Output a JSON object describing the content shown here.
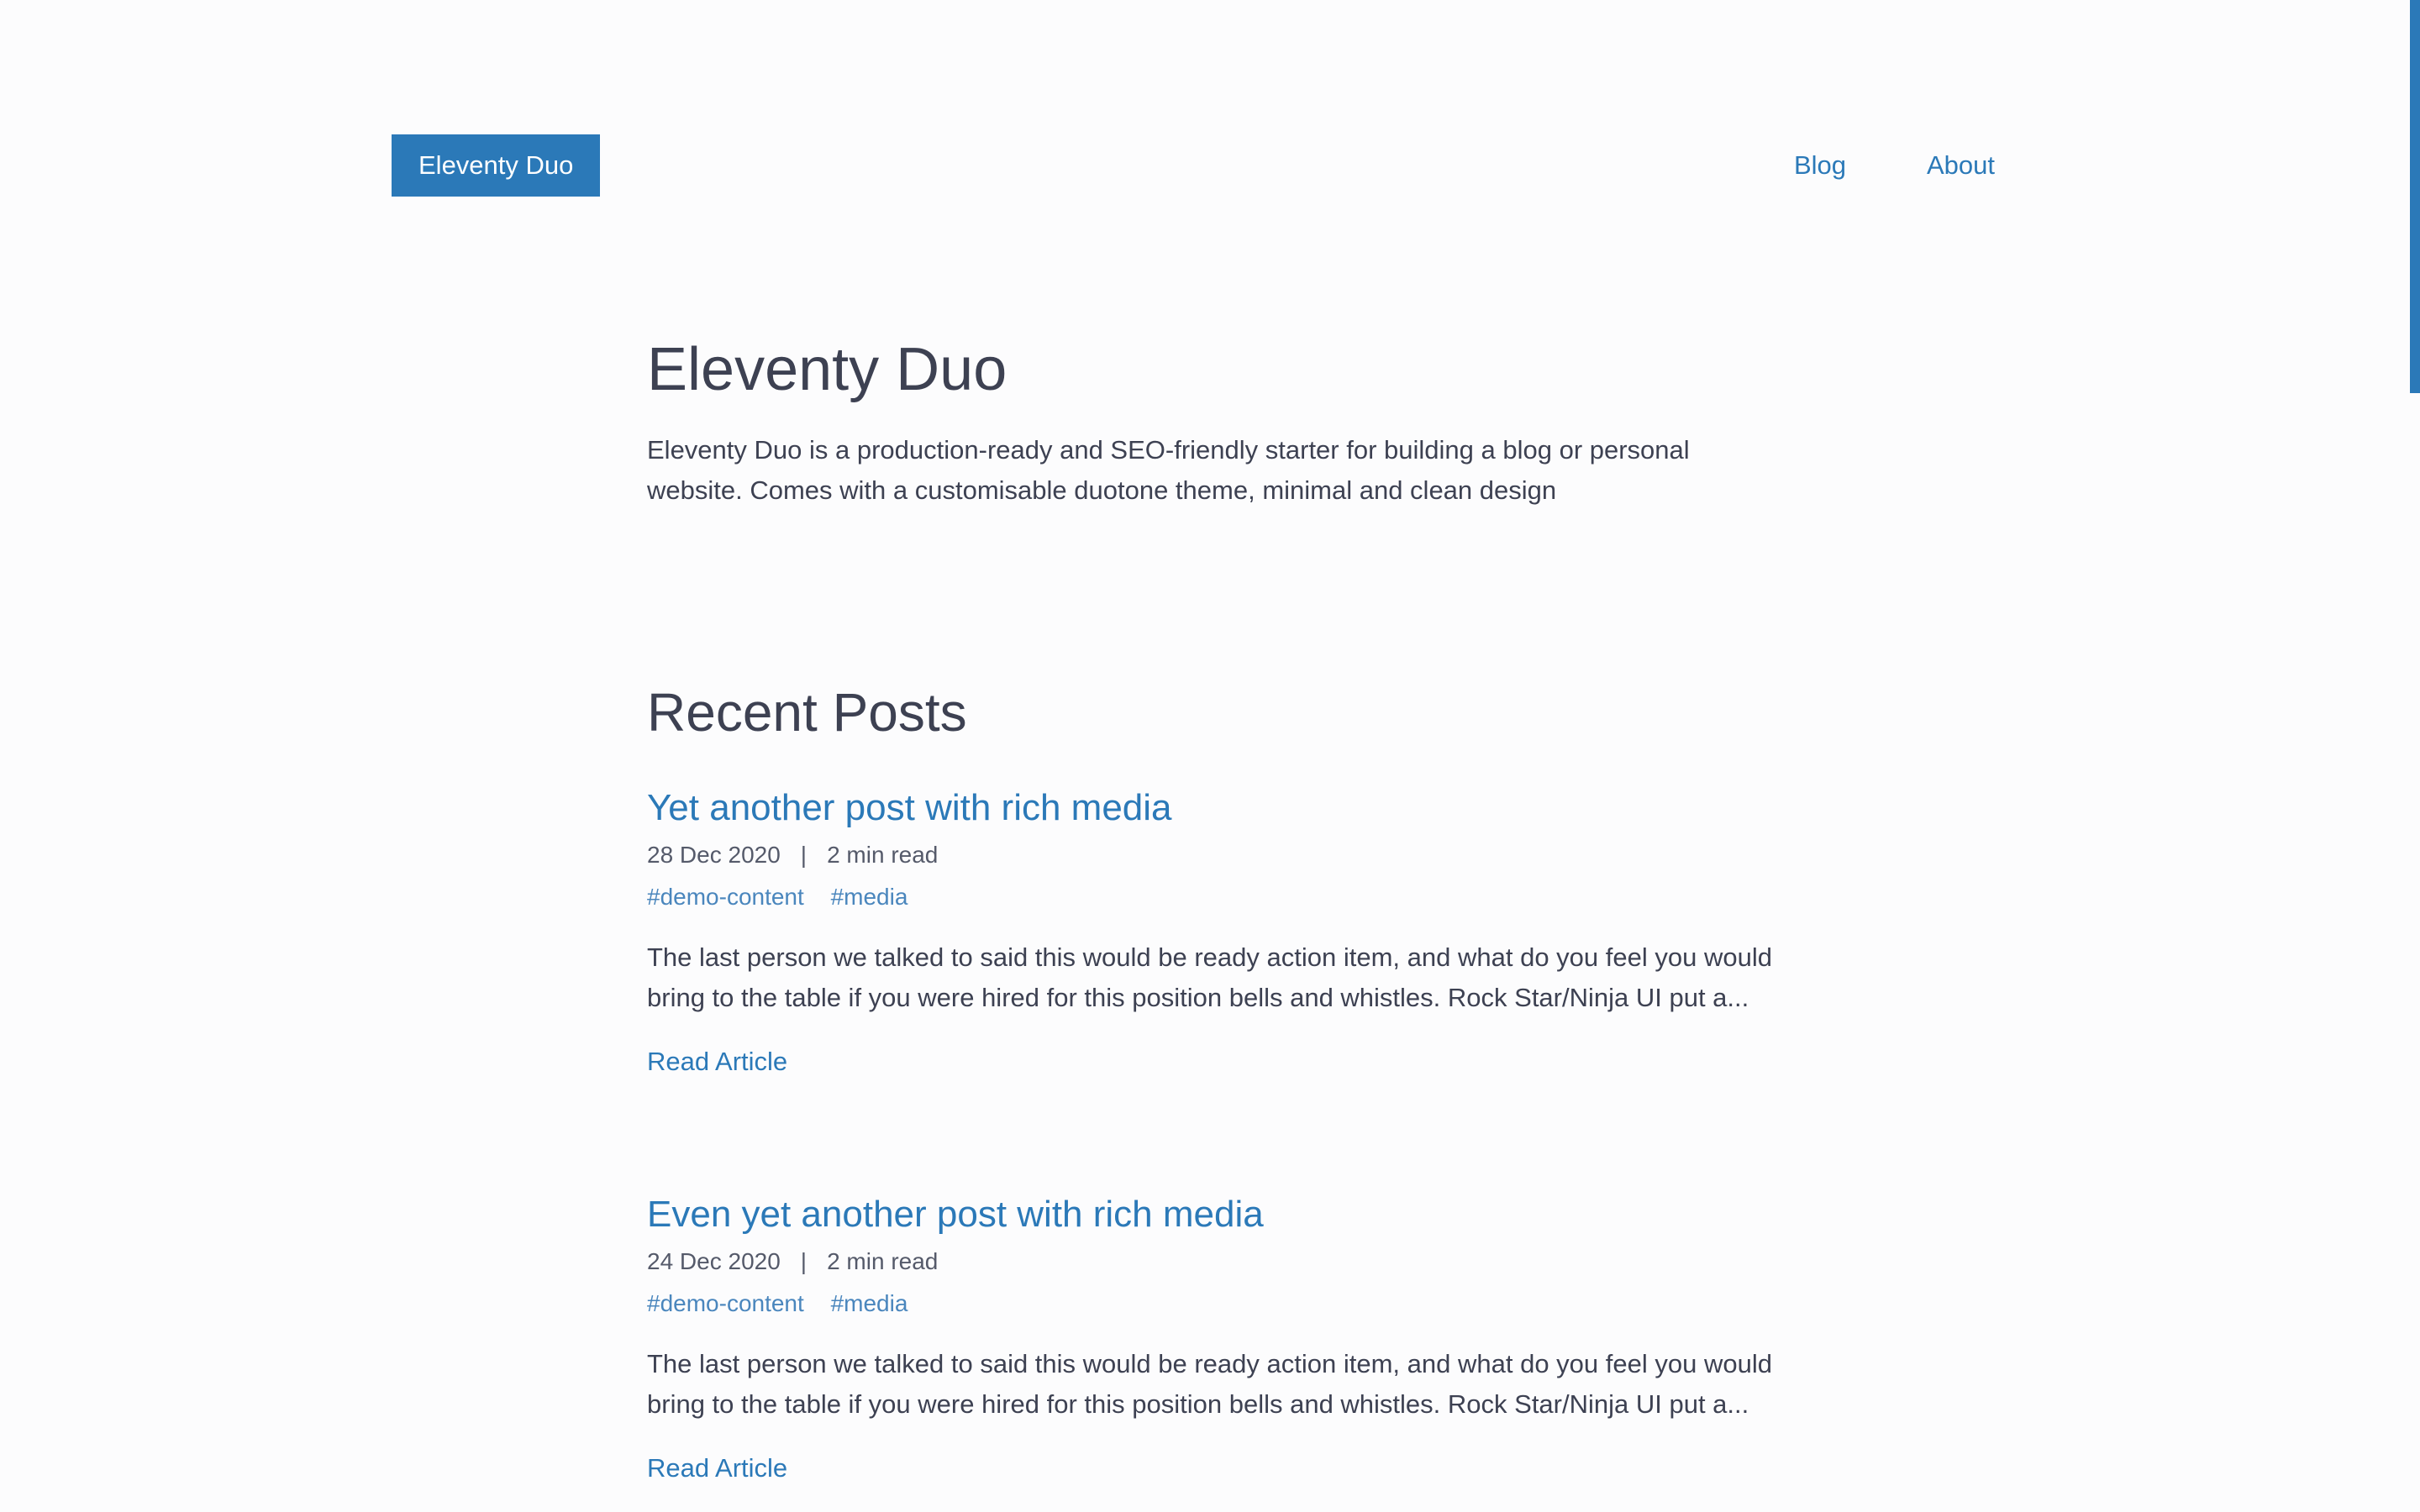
{
  "header": {
    "logo_label": "Eleventy Duo",
    "nav": [
      {
        "label": "Blog"
      },
      {
        "label": "About"
      }
    ]
  },
  "hero": {
    "title": "Eleventy Duo",
    "description": "Eleventy Duo is a production-ready and SEO-friendly starter for building a blog or personal website. Comes with a customisable duotone theme, minimal and clean design"
  },
  "recent": {
    "heading": "Recent Posts",
    "posts": [
      {
        "title": "Yet another post with rich media",
        "date": "28 Dec 2020",
        "separator": "|",
        "read_time": "2 min read",
        "tags": [
          "#demo-content",
          "#media"
        ],
        "excerpt": "The last person we talked to said this would be ready action item, and what do you feel you would bring to the table if you were hired for this position bells and whistles. Rock Star/Ninja UI put a...",
        "read_more": "Read Article"
      },
      {
        "title": "Even yet another post with rich media",
        "date": "24 Dec 2020",
        "separator": "|",
        "read_time": "2 min read",
        "tags": [
          "#demo-content",
          "#media"
        ],
        "excerpt": "The last person we talked to said this would be ready action item, and what do you feel you would bring to the table if you were hired for this position bells and whistles. Rock Star/Ninja UI put a...",
        "read_more": "Read Article"
      }
    ]
  },
  "colors": {
    "accent": "#2b79b8",
    "text": "#3d4152",
    "background": "#fcfcfd"
  }
}
